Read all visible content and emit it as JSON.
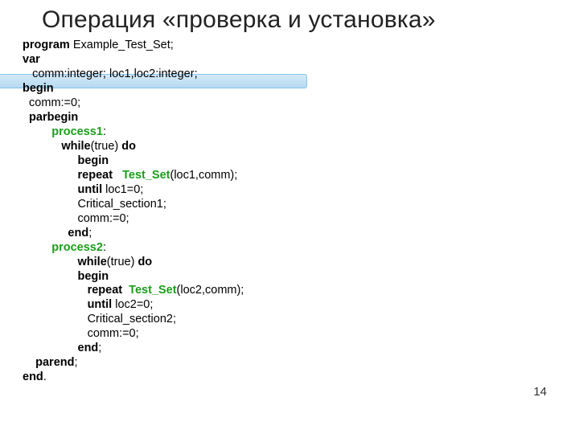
{
  "title": "Операция «проверка и установка»",
  "page_number": "14",
  "code": {
    "l1_kw": "program",
    "l1_rest": " Example_Test_Set;",
    "l2": "var",
    "l3": "   comm:integer; loc1,loc2:integer;",
    "l4": "begin",
    "l5": "  comm:=0;",
    "l6": "  parbegin",
    "l7_pn": "         process1",
    "l7_rest": ":",
    "l8_i": "            ",
    "l8_kw": "while",
    "l8_m": "(true) ",
    "l8_do": "do",
    "l9_i": "                 ",
    "l9_kw": "begin",
    "l10_i": "                 ",
    "l10_kw": "repeat   ",
    "l10_ts": "Test_Set",
    "l10_rest": "(loc1,comm);",
    "l11_i": "                 ",
    "l11_kw": "until",
    "l11_rest": " loc1=0;",
    "l12": "                 Critical_section1;",
    "l13": "                 comm:=0;",
    "l14_i": "              ",
    "l14_kw": "end",
    "l14_rest": ";",
    "l15_pn": "         process2",
    "l15_rest": ":",
    "l16_i": "                 ",
    "l16_kw": "while",
    "l16_m": "(true) ",
    "l16_do": "do",
    "l17_i": "                 ",
    "l17_kw": "begin",
    "l18_i": "                    ",
    "l18_kw": "repeat  ",
    "l18_ts": "Test_Set",
    "l18_rest": "(loc2,comm);",
    "l19_i": "                    ",
    "l19_kw": "until",
    "l19_rest": " loc2=0;",
    "l20": "                    Critical_section2;",
    "l21": "                    comm:=0;",
    "l22_i": "                 ",
    "l22_kw": "end",
    "l22_rest": ";",
    "l23_i": "    ",
    "l23_kw": "parend",
    "l23_rest": ";",
    "l24_kw": "end",
    "l24_rest": "."
  }
}
